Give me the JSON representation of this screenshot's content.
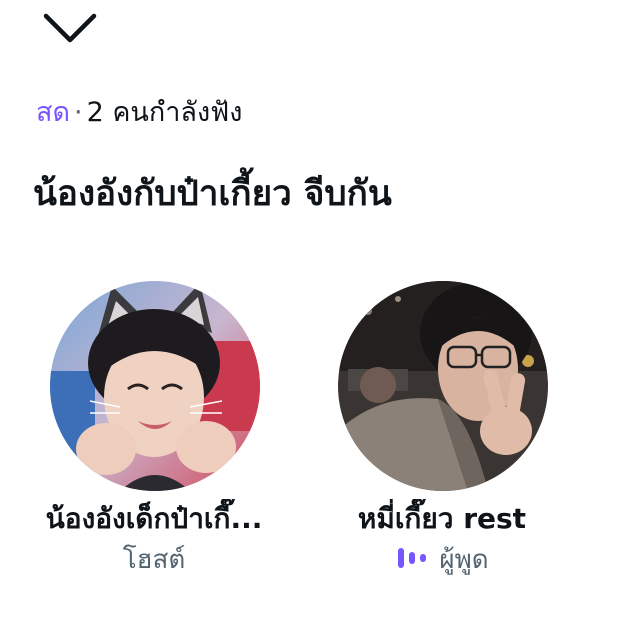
{
  "header": {
    "collapse_icon": "chevron-down-icon"
  },
  "space": {
    "live_label": "สด",
    "separator": "·",
    "listeners_text": "2 คนกำลังฟัง",
    "title": "น้องอังกับป๋าเกี้ยว จีบกัน"
  },
  "participants": [
    {
      "name": "น้องอังเด็กป๋าเกี๊...",
      "role": "โฮสต์",
      "avatar_icon": "profile-photo"
    },
    {
      "name": "หมี่เกี๊ยว rest",
      "role": "ผู้พูด",
      "role_icon": "speaking-icon",
      "avatar_icon": "profile-photo"
    }
  ],
  "colors": {
    "accent": "#7856ff",
    "secondary_text": "#536471",
    "primary_text": "#0f1419"
  }
}
